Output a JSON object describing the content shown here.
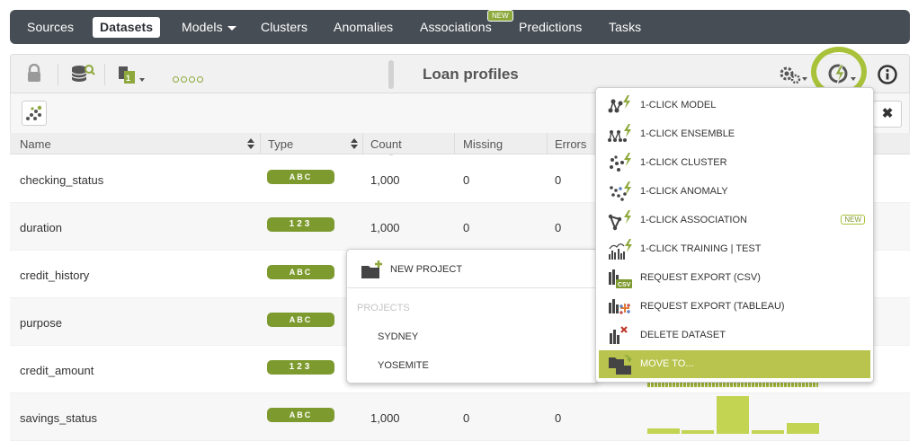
{
  "nav": {
    "items": [
      {
        "label": "Sources"
      },
      {
        "label": "Datasets"
      },
      {
        "label": "Models"
      },
      {
        "label": "Clusters"
      },
      {
        "label": "Anomalies"
      },
      {
        "label": "Associations"
      },
      {
        "label": "Predictions"
      },
      {
        "label": "Tasks"
      }
    ],
    "new_badge": "NEW"
  },
  "toolbar": {
    "title": "Loan profiles"
  },
  "table": {
    "headers": [
      "Name",
      "Type",
      "Count",
      "Missing",
      "Errors"
    ],
    "rows": [
      {
        "name": "checking_status",
        "type": "ABC",
        "count": "1,000",
        "missing": "0",
        "errors": "0"
      },
      {
        "name": "duration",
        "type": "123",
        "count": "1,000",
        "missing": "0",
        "errors": "0"
      },
      {
        "name": "credit_history",
        "type": "ABC",
        "count": "",
        "missing": "",
        "errors": ""
      },
      {
        "name": "purpose",
        "type": "ABC",
        "count": "",
        "missing": "",
        "errors": ""
      },
      {
        "name": "credit_amount",
        "type": "123",
        "count": "",
        "missing": "",
        "errors": ""
      },
      {
        "name": "savings_status",
        "type": "ABC",
        "count": "1,000",
        "missing": "0",
        "errors": "0"
      }
    ]
  },
  "project_popup": {
    "new_project": "NEW PROJECT",
    "projects_header": "PROJECTS",
    "projects": [
      "SYDNEY",
      "YOSEMITE"
    ]
  },
  "oneclick_menu": {
    "items": [
      {
        "label": "1-CLICK MODEL"
      },
      {
        "label": "1-CLICK ENSEMBLE"
      },
      {
        "label": "1-CLICK CLUSTER"
      },
      {
        "label": "1-CLICK ANOMALY"
      },
      {
        "label": "1-CLICK ASSOCIATION",
        "badge": "NEW"
      },
      {
        "label": "1-CLICK TRAINING | TEST"
      },
      {
        "label": "REQUEST EXPORT (CSV)"
      },
      {
        "label": "REQUEST EXPORT (TABLEAU)"
      },
      {
        "label": "DELETE DATASET"
      },
      {
        "label": "MOVE TO..."
      }
    ],
    "active_index": 9
  },
  "colors": {
    "nav_bg": "#464d54",
    "accent": "#7d9a2e",
    "highlight": "#a8c23a",
    "hist": "#c2d452",
    "menu_active": "#b9c44e"
  }
}
